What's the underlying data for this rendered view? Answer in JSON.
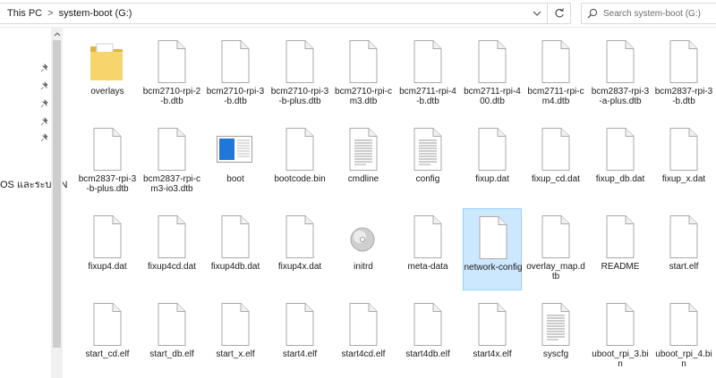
{
  "breadcrumb": {
    "root": "This PC",
    "separator": ">",
    "current": "system-boot (G:)"
  },
  "search": {
    "placeholder": "Search system-boot (G:)"
  },
  "nav": {
    "visible_label": "OS และระบบ N"
  },
  "colors": {
    "selection_fill": "#cce8ff",
    "selection_border": "#99d1ff",
    "folder": "#f7d56c"
  },
  "files": [
    {
      "name": "overlays",
      "icon": "folder-icon"
    },
    {
      "name": "bcm2710-rpi-2-b.dtb",
      "icon": "file-icon"
    },
    {
      "name": "bcm2710-rpi-3-b.dtb",
      "icon": "file-icon"
    },
    {
      "name": "bcm2710-rpi-3-b-plus.dtb",
      "icon": "file-icon"
    },
    {
      "name": "bcm2710-rpi-cm3.dtb",
      "icon": "file-icon"
    },
    {
      "name": "bcm2711-rpi-4-b.dtb",
      "icon": "file-icon"
    },
    {
      "name": "bcm2711-rpi-400.dtb",
      "icon": "file-icon"
    },
    {
      "name": "bcm2711-rpi-cm4.dtb",
      "icon": "file-icon"
    },
    {
      "name": "bcm2837-rpi-3-a-plus.dtb",
      "icon": "file-icon"
    },
    {
      "name": "bcm2837-rpi-3-b.dtb",
      "icon": "file-icon"
    },
    {
      "name": "bcm2837-rpi-3-b-plus.dtb",
      "icon": "file-icon"
    },
    {
      "name": "bcm2837-rpi-cm3-io3.dtb",
      "icon": "file-icon"
    },
    {
      "name": "boot",
      "icon": "bitmap-image-icon"
    },
    {
      "name": "bootcode.bin",
      "icon": "file-icon"
    },
    {
      "name": "cmdline",
      "icon": "text-document-icon"
    },
    {
      "name": "config",
      "icon": "text-document-icon"
    },
    {
      "name": "fixup.dat",
      "icon": "file-icon"
    },
    {
      "name": "fixup_cd.dat",
      "icon": "file-icon"
    },
    {
      "name": "fixup_db.dat",
      "icon": "file-icon"
    },
    {
      "name": "fixup_x.dat",
      "icon": "file-icon"
    },
    {
      "name": "fixup4.dat",
      "icon": "file-icon"
    },
    {
      "name": "fixup4cd.dat",
      "icon": "file-icon"
    },
    {
      "name": "fixup4db.dat",
      "icon": "file-icon"
    },
    {
      "name": "fixup4x.dat",
      "icon": "file-icon"
    },
    {
      "name": "initrd",
      "icon": "disc-image-icon"
    },
    {
      "name": "meta-data",
      "icon": "file-icon"
    },
    {
      "name": "network-config",
      "icon": "file-icon",
      "selected": true
    },
    {
      "name": "overlay_map.dtb",
      "icon": "file-icon"
    },
    {
      "name": "README",
      "icon": "file-icon"
    },
    {
      "name": "start.elf",
      "icon": "file-icon"
    },
    {
      "name": "start_cd.elf",
      "icon": "file-icon"
    },
    {
      "name": "start_db.elf",
      "icon": "file-icon"
    },
    {
      "name": "start_x.elf",
      "icon": "file-icon"
    },
    {
      "name": "start4.elf",
      "icon": "file-icon"
    },
    {
      "name": "start4cd.elf",
      "icon": "file-icon"
    },
    {
      "name": "start4db.elf",
      "icon": "file-icon"
    },
    {
      "name": "start4x.elf",
      "icon": "file-icon"
    },
    {
      "name": "syscfg",
      "icon": "text-document-icon"
    },
    {
      "name": "uboot_rpi_3.bin",
      "icon": "file-icon"
    },
    {
      "name": "uboot_rpi_4.bin",
      "icon": "file-icon"
    }
  ]
}
